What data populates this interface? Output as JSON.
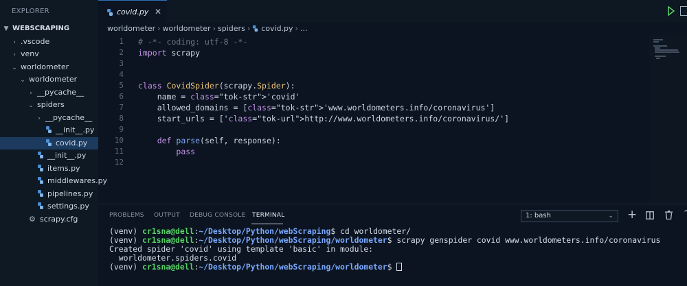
{
  "sidebar": {
    "title": "EXPLORER",
    "root": "WEBSCRAPING",
    "items": [
      {
        "label": ".vscode",
        "type": "folder",
        "depth": 1,
        "expanded": false
      },
      {
        "label": "venv",
        "type": "folder",
        "depth": 1,
        "expanded": false
      },
      {
        "label": "worldometer",
        "type": "folder",
        "depth": 1,
        "expanded": true
      },
      {
        "label": "worldometer",
        "type": "folder",
        "depth": 2,
        "expanded": true
      },
      {
        "label": "__pycache__",
        "type": "folder",
        "depth": 3,
        "expanded": false
      },
      {
        "label": "spiders",
        "type": "folder",
        "depth": 3,
        "expanded": true
      },
      {
        "label": "__pycache__",
        "type": "folder",
        "depth": 4,
        "expanded": false
      },
      {
        "label": "__init__.py",
        "type": "python",
        "depth": 4
      },
      {
        "label": "covid.py",
        "type": "python",
        "depth": 4,
        "selected": true
      },
      {
        "label": "__init__.py",
        "type": "python",
        "depth": 3
      },
      {
        "label": "items.py",
        "type": "python",
        "depth": 3
      },
      {
        "label": "middlewares.py",
        "type": "python",
        "depth": 3
      },
      {
        "label": "pipelines.py",
        "type": "python",
        "depth": 3
      },
      {
        "label": "settings.py",
        "type": "python",
        "depth": 3
      },
      {
        "label": "scrapy.cfg",
        "type": "config",
        "depth": 2
      }
    ]
  },
  "editor": {
    "tab_label": "covid.py",
    "breadcrumb": [
      "worldometer",
      "worldometer",
      "spiders",
      "covid.py",
      "..."
    ],
    "lines": [
      {
        "n": "1",
        "text": "# -*- coding: utf-8 -*-"
      },
      {
        "n": "2",
        "text": "import scrapy"
      },
      {
        "n": "3",
        "text": ""
      },
      {
        "n": "4",
        "text": ""
      },
      {
        "n": "5",
        "text": "class CovidSpider(scrapy.Spider):"
      },
      {
        "n": "6",
        "text": "    name = 'covid'"
      },
      {
        "n": "7",
        "text": "    allowed_domains = ['www.worldometers.info/coronavirus']"
      },
      {
        "n": "8",
        "text": "    start_urls = ['http://www.worldometers.info/coronavirus/']"
      },
      {
        "n": "9",
        "text": ""
      },
      {
        "n": "10",
        "text": "    def parse(self, response):"
      },
      {
        "n": "11",
        "text": "        pass"
      },
      {
        "n": "12",
        "text": ""
      }
    ]
  },
  "panel": {
    "tabs": [
      "PROBLEMS",
      "OUTPUT",
      "DEBUG CONSOLE",
      "TERMINAL"
    ],
    "active_tab": "TERMINAL",
    "terminal_select": "1: bash",
    "terminal": [
      {
        "prefix": "(venv) ",
        "user": "cr1sna@dell",
        "colon": ":",
        "path": "~/Desktop/Python/webScraping",
        "cmd": "$ cd worldometer/"
      },
      {
        "prefix": "(venv) ",
        "user": "cr1sna@dell",
        "colon": ":",
        "path": "~/Desktop/Python/webScraping/worldometer",
        "cmd": "$ scrapy genspider covid www.worldometers.info/coronavirus"
      },
      {
        "text": "Created spider 'covid' using template 'basic' in module:"
      },
      {
        "text": "  worldometer.spiders.covid"
      },
      {
        "prefix": "(venv) ",
        "user": "cr1sna@dell",
        "colon": ":",
        "path": "~/Desktop/Python/webScraping/worldometer",
        "cmd": "$ ",
        "cursor": true
      }
    ]
  },
  "colors": {
    "background": "#0b1420",
    "sidebar": "#0f1923",
    "selection": "#1b3a5e",
    "keyword": "#c792ea",
    "class_name": "#f2c879",
    "terminal_user": "#56d364",
    "terminal_path": "#79a8ff"
  }
}
